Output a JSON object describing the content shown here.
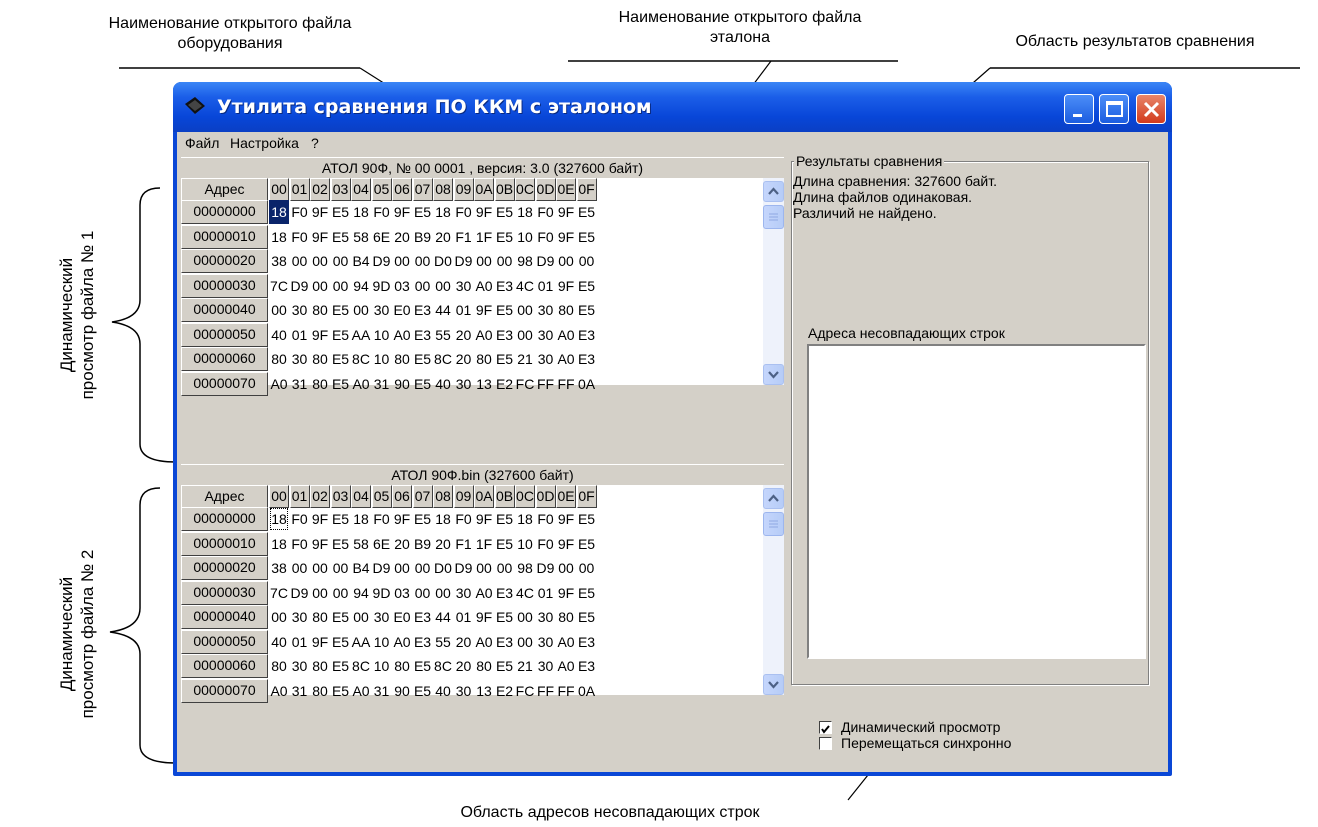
{
  "callouts": {
    "equipment_file_name": "Наименование открытого файла\nоборудования",
    "reference_file_name": "Наименование открытого файла\nэталона",
    "results_area": "Область результатов сравнения",
    "mismatch_area": "Область адресов несовпадающих строк",
    "view1": "Динамический\nпросмотр файла  № 1",
    "view2": "Динамический\nпросмотр файла № 2"
  },
  "window": {
    "title": "Утилита сравнения ПО ККМ с эталоном",
    "menu": [
      "Файл",
      "Настройка",
      "?"
    ]
  },
  "panel1": {
    "header": "АТОЛ 90Ф, № 00 0001 , версия: 3.0 (327600 байт)"
  },
  "panel2": {
    "header": "АТОЛ 90Ф.bin (327600 байт)"
  },
  "grid": {
    "address_header": "Адрес",
    "columns": [
      "00",
      "01",
      "02",
      "03",
      "04",
      "05",
      "06",
      "07",
      "08",
      "09",
      "0A",
      "0B",
      "0C",
      "0D",
      "0E",
      "0F"
    ],
    "addresses": [
      "00000000",
      "00000010",
      "00000020",
      "00000030",
      "00000040",
      "00000050",
      "00000060",
      "00000070"
    ],
    "rows": [
      [
        "18",
        "F0",
        "9F",
        "E5",
        "18",
        "F0",
        "9F",
        "E5",
        "18",
        "F0",
        "9F",
        "E5",
        "18",
        "F0",
        "9F",
        "E5"
      ],
      [
        "18",
        "F0",
        "9F",
        "E5",
        "58",
        "6E",
        "20",
        "B9",
        "20",
        "F1",
        "1F",
        "E5",
        "10",
        "F0",
        "9F",
        "E5"
      ],
      [
        "38",
        "00",
        "00",
        "00",
        "B4",
        "D9",
        "00",
        "00",
        "D0",
        "D9",
        "00",
        "00",
        "98",
        "D9",
        "00",
        "00"
      ],
      [
        "7C",
        "D9",
        "00",
        "00",
        "94",
        "9D",
        "03",
        "00",
        "00",
        "30",
        "A0",
        "E3",
        "4C",
        "01",
        "9F",
        "E5"
      ],
      [
        "00",
        "30",
        "80",
        "E5",
        "00",
        "30",
        "E0",
        "E3",
        "44",
        "01",
        "9F",
        "E5",
        "00",
        "30",
        "80",
        "E5"
      ],
      [
        "40",
        "01",
        "9F",
        "E5",
        "AA",
        "10",
        "A0",
        "E3",
        "55",
        "20",
        "A0",
        "E3",
        "00",
        "30",
        "A0",
        "E3"
      ],
      [
        "80",
        "30",
        "80",
        "E5",
        "8C",
        "10",
        "80",
        "E5",
        "8C",
        "20",
        "80",
        "E5",
        "21",
        "30",
        "A0",
        "E3"
      ],
      [
        "A0",
        "31",
        "80",
        "E5",
        "A0",
        "31",
        "90",
        "E5",
        "40",
        "30",
        "13",
        "E2",
        "FC",
        "FF",
        "FF",
        "0A"
      ]
    ]
  },
  "results": {
    "group_title": "Результаты сравнения",
    "lines": [
      "Длина сравнения: 327600 байт.",
      "Длина файлов одинаковая.",
      "Различий не найдено."
    ],
    "mismatch_label": "Адреса несовпадающих строк"
  },
  "options": {
    "dynamic_view": {
      "label": "Динамический просмотр",
      "checked": true
    },
    "sync_move": {
      "label": "Перемещаться синхронно",
      "checked": false
    }
  }
}
